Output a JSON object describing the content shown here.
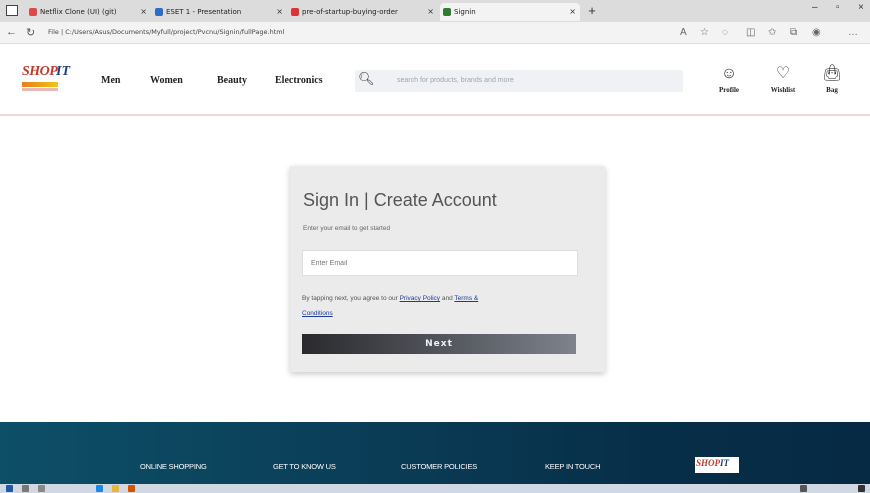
{
  "browser": {
    "tabs": [
      {
        "label": "Netflix Clone (UI) (git)",
        "favicon_color": "#e04747"
      },
      {
        "label": "ESET 1 - Presentation",
        "favicon_color": "#2b6cc4"
      },
      {
        "label": "pre-of-startup-buying-order",
        "favicon_color": "#d33"
      },
      {
        "label": "Signin",
        "favicon_color": "#2e7d32"
      }
    ],
    "url": "File | C:/Users/Asus/Documents/Myfull/project/Pvcnu/Signin/fullPage.html"
  },
  "header": {
    "logo": {
      "shop": "SHOP",
      "it": "IT"
    },
    "nav": [
      "Men",
      "Women",
      "Beauty",
      "Electronics"
    ],
    "search_placeholder": "search for products, brands and more",
    "actions": [
      {
        "label": "Profile",
        "icon": "user-icon"
      },
      {
        "label": "Wishlist",
        "icon": "wishlist-icon"
      },
      {
        "label": "Bag",
        "icon": "bag-icon"
      }
    ]
  },
  "signin": {
    "title": "Sign In | Create Account",
    "subtitle": "Enter your email to get started",
    "email_placeholder": "Enter Email",
    "terms_prefix": "By tapping next, you agree to our ",
    "privacy_link": "Privacy Policy",
    "terms_middle": " and ",
    "terms_link": "Terms &",
    "terms_link2": "Conditions",
    "next_button": "Next"
  },
  "footer": {
    "columns": [
      "ONLINE SHOPPING",
      "GET TO KNOW US",
      "CUSTOMER POLICIES",
      "KEEP IN TOUCH"
    ],
    "logo": {
      "shop": "SHOP",
      "it": "IT"
    }
  },
  "colors": {
    "accent_red": "#c0392b",
    "accent_blue": "#1f3b7a",
    "footer_bg": "#0b3e58",
    "card_bg": "#ebebeb"
  }
}
